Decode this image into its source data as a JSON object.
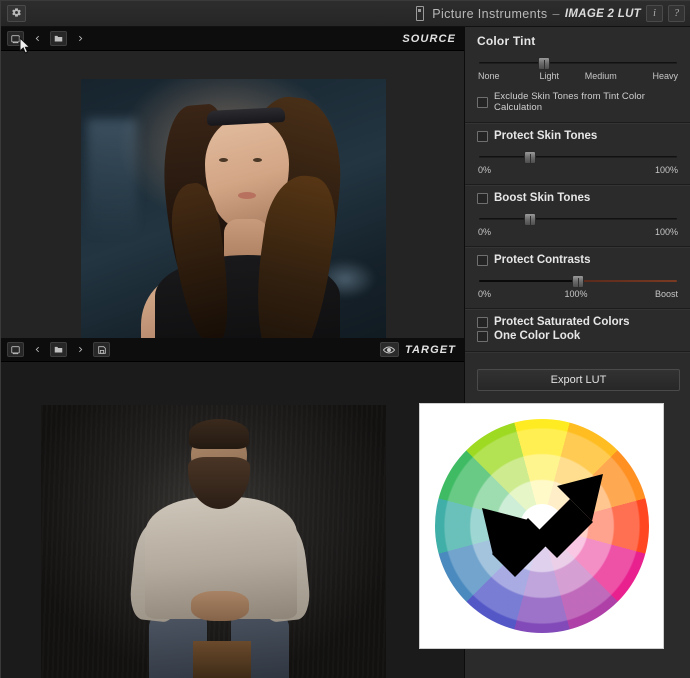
{
  "titlebar": {
    "gear_icon": "gear-icon",
    "brand": "Picture Instruments",
    "separator": "–",
    "product": "IMAGE 2 LUT",
    "info_button": "i",
    "help_button": "?"
  },
  "source_pane": {
    "label": "SOURCE",
    "toolbar": [
      {
        "icon": "screen-capture-icon",
        "name": "capture-source"
      },
      {
        "icon": "chevron-left-icon",
        "name": "previous-source"
      },
      {
        "icon": "folder-icon",
        "name": "open-source-folder"
      },
      {
        "icon": "chevron-right-icon",
        "name": "next-source"
      }
    ]
  },
  "target_pane": {
    "label": "TARGET",
    "eye_icon": "eye-icon",
    "toolbar": [
      {
        "icon": "screen-capture-icon",
        "name": "capture-target"
      },
      {
        "icon": "chevron-left-icon",
        "name": "previous-target"
      },
      {
        "icon": "folder-icon",
        "name": "open-target-folder"
      },
      {
        "icon": "chevron-right-icon",
        "name": "next-target"
      },
      {
        "icon": "save-icon",
        "name": "save-target"
      }
    ]
  },
  "panel": {
    "color_tint": {
      "title": "Color Tint",
      "slider_value_pct": 33,
      "ticks": [
        "None",
        "Light",
        "Medium",
        "Heavy"
      ],
      "exclude_skin_tones": {
        "label": "Exclude Skin Tones from Tint Color Calculation",
        "checked": false
      }
    },
    "protect_skin_tones": {
      "label": "Protect Skin Tones",
      "checked": false,
      "slider_value_pct": 26,
      "ticks": [
        "0%",
        "100%"
      ]
    },
    "boost_skin_tones": {
      "label": "Boost Skin Tones",
      "checked": false,
      "slider_value_pct": 26,
      "ticks": [
        "0%",
        "100%"
      ]
    },
    "protect_contrasts": {
      "label": "Protect Contrasts",
      "checked": false,
      "slider_value_pct": 50,
      "ticks": [
        "0%",
        "100%",
        "Boost"
      ]
    },
    "protect_saturated_colors": {
      "label": "Protect Saturated Colors",
      "checked": false
    },
    "one_color_look": {
      "label": "One Color Look",
      "checked": false
    },
    "export_button": "Export LUT"
  },
  "color_wheel": {
    "name": "color-wheel-overlay",
    "segments": 12,
    "arrow": "double-headed-arrow",
    "arrow_direction": "lower-left to upper-right",
    "background": "#ffffff"
  }
}
